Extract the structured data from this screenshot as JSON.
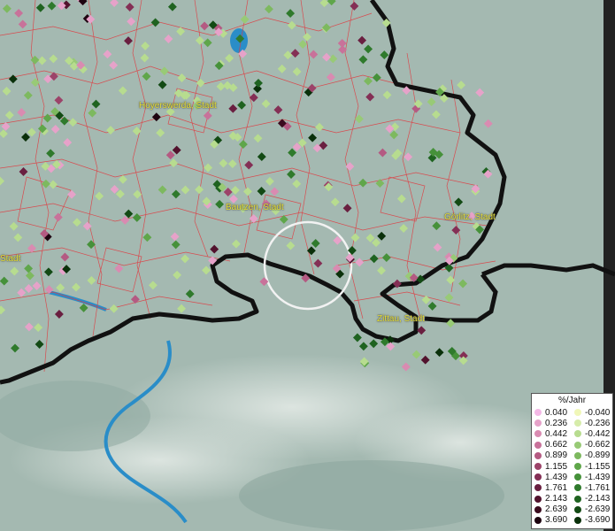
{
  "cities": [
    {
      "id": "hoyerswerda",
      "label": "Hoyerswerda, Stadt"
    },
    {
      "id": "bautzen",
      "label": "Bautzen, Stadt"
    },
    {
      "id": "goerlitz",
      "label": "Görlitz, Stadt"
    },
    {
      "id": "zittau",
      "label": "Zittau, Stadt"
    },
    {
      "id": "edge",
      "label": "Stadt"
    }
  ],
  "legend": {
    "title": "%/Jahr",
    "positive": [
      "0.040",
      "0.236",
      "0.442",
      "0.662",
      "0.899",
      "1.155",
      "1.439",
      "1.761",
      "2.143",
      "2.639",
      "3.690"
    ],
    "negative": [
      "-0.040",
      "-0.236",
      "-0.442",
      "-0.662",
      "-0.899",
      "-1.155",
      "-1.439",
      "-1.761",
      "-2.143",
      "-2.639",
      "-3.690"
    ],
    "positive_colors": [
      "#f4b8e6",
      "#e6a2c9",
      "#d98bb1",
      "#c8729a",
      "#b45a82",
      "#9c4369",
      "#842f55",
      "#6a1f40",
      "#52122d",
      "#3b0a1e",
      "#1e0410"
    ],
    "negative_colors": [
      "#f0f7b8",
      "#d6ecaa",
      "#b7dc8f",
      "#98ca76",
      "#7db95f",
      "#5fa64a",
      "#46913a",
      "#2f7a2c",
      "#1f6320",
      "#134a14",
      "#0a300a"
    ]
  },
  "colors": {
    "border": "#111111",
    "districts": "#e0393f",
    "water": "#2a8dc8"
  }
}
